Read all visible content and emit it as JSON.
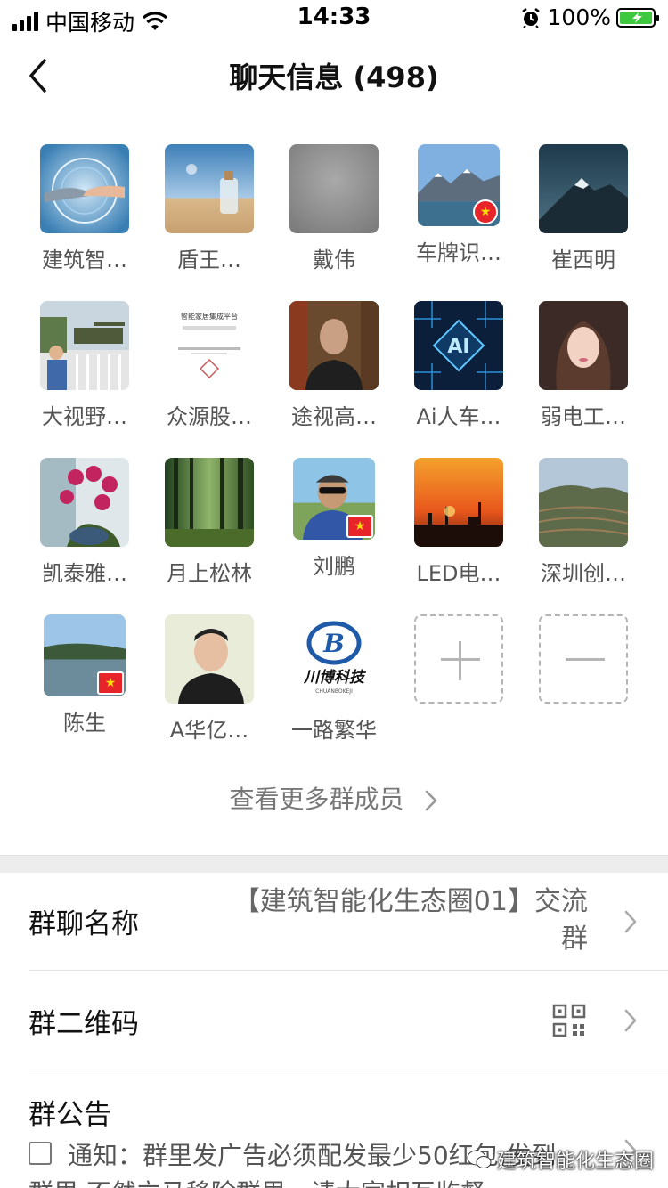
{
  "status_bar": {
    "carrier": "中国移动",
    "time": "14:33",
    "battery": "100%"
  },
  "nav": {
    "title": "聊天信息 (498)"
  },
  "members": [
    {
      "name": "建筑智…",
      "avatar": "robot-handshake-avatar"
    },
    {
      "name": "盾王…",
      "avatar": "bottle-beach-avatar"
    },
    {
      "name": "戴伟",
      "avatar": "gray-avatar"
    },
    {
      "name": "车牌识…",
      "avatar": "mountain-lake-avatar",
      "flag": true
    },
    {
      "name": "崔西明",
      "avatar": "snow-mountain-avatar"
    },
    {
      "name": "大视野…",
      "avatar": "tank-man-avatar"
    },
    {
      "name": "众源股…",
      "avatar": "company-card-avatar"
    },
    {
      "name": "途视高…",
      "avatar": "man-portrait-avatar"
    },
    {
      "name": "Ai人车…",
      "avatar": "ai-chip-avatar"
    },
    {
      "name": "弱电工…",
      "avatar": "woman-portrait-avatar"
    },
    {
      "name": "凯泰雅…",
      "avatar": "orchid-avatar"
    },
    {
      "name": "月上松林",
      "avatar": "forest-avatar"
    },
    {
      "name": "刘鹏",
      "avatar": "man-sunglasses-avatar",
      "flag": true
    },
    {
      "name": "LED电…",
      "avatar": "sunset-city-avatar"
    },
    {
      "name": "深圳创…",
      "avatar": "terraced-field-avatar"
    },
    {
      "name": "陈生",
      "avatar": "lake-avatar",
      "flag": true
    },
    {
      "name": "A华亿…",
      "avatar": "young-man-avatar"
    },
    {
      "name": "一路繁华",
      "avatar": "chuanbo-logo-avatar"
    }
  ],
  "logo_text": {
    "chuanbo": "川博科技",
    "chuanbo_en": "CHUANBOKEJI",
    "company_card": "智能家居集成平台"
  },
  "more_members": "查看更多群成员",
  "group_name": {
    "label": "群聊名称",
    "value_line1": "【建筑智能化生态圈01】交流",
    "value_line2": "群"
  },
  "qr_code": {
    "label": "群二维码"
  },
  "announcement": {
    "label": "群公告",
    "line1": "通知：群里发广告必须配发最少50红包,发到",
    "line2": "群里,不然立马移除群里，请大家相互监督"
  },
  "watermark": "建筑智能化生态圈"
}
